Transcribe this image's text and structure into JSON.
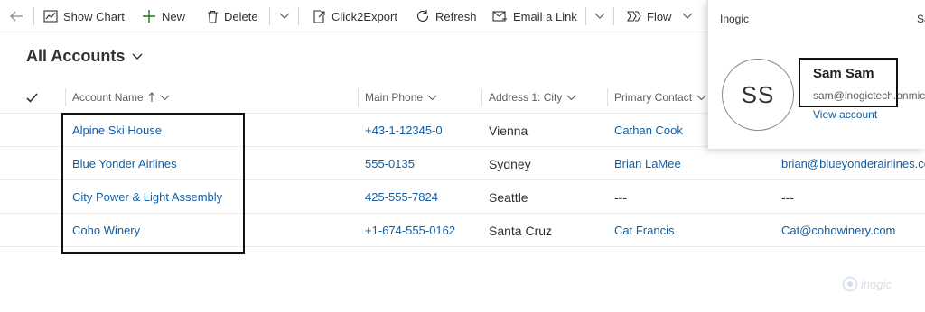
{
  "command_bar": {
    "show_chart": "Show Chart",
    "new": "New",
    "delete": "Delete",
    "click2export": "Click2Export",
    "refresh": "Refresh",
    "email_link": "Email a Link",
    "flow": "Flow"
  },
  "view": {
    "title": "All Accounts"
  },
  "grid": {
    "columns": {
      "account_name": "Account Name",
      "main_phone": "Main Phone",
      "city": "Address 1: City",
      "primary_contact": "Primary Contact"
    },
    "rows": [
      {
        "name": "Alpine Ski House",
        "phone": "+43-1-12345-0",
        "city": "Vienna",
        "contact": "Cathan Cook",
        "email": ""
      },
      {
        "name": "Blue Yonder Airlines",
        "phone": "555-0135",
        "city": "Sydney",
        "contact": "Brian LaMee",
        "email": "brian@blueyonderairlines.co"
      },
      {
        "name": "City Power & Light Assembly",
        "phone": "425-555-7824",
        "city": "Seattle",
        "contact": "---",
        "email": "---"
      },
      {
        "name": "Coho Winery",
        "phone": "+1-674-555-0162",
        "city": "Santa Cruz",
        "contact": "Cat Francis",
        "email": "Cat@cohowinery.com"
      }
    ]
  },
  "profile": {
    "org": "Inogic",
    "org_trailing": "Sa",
    "initials": "SS",
    "name": "Sam Sam",
    "email": "sam@inogictech.onmicr",
    "view_account": "View account"
  },
  "watermark": {
    "text": "inogic"
  },
  "colors": {
    "link": "#115ea3",
    "accent": "#0078d4"
  }
}
